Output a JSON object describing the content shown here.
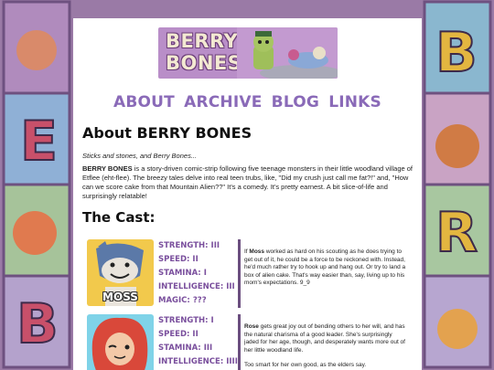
{
  "banner": {
    "title_line1": "BERRY",
    "title_line2": "BONES"
  },
  "nav": {
    "items": [
      "ABOUT",
      "ARCHIVE",
      "BLOG",
      "LINKS"
    ]
  },
  "about": {
    "title": "About BERRY BONES",
    "tagline": "Sticks and stones, and Berry Bones...",
    "intro_bold": "BERRY BONES",
    "intro_rest": " is a story-driven comic-strip following five teenage monsters in their little woodland village of Etflee (eht-flee). The breezy tales delve into real teen trubs, like, \"Did my crush just call me fat?!\" and, \"How can we score cake from that Mountain Alien??\" It's a comedy. It's pretty earnest. A bit slice-of-life and surprisingly relatable!"
  },
  "cast": {
    "title": "The Cast:",
    "characters": [
      {
        "name": "MOSS",
        "portrait_bg": "#f2c94c",
        "stats": [
          {
            "label": "STRENGTH:",
            "value": "III"
          },
          {
            "label": "SPEED:",
            "value": "II"
          },
          {
            "label": "STAMINA:",
            "value": "I"
          },
          {
            "label": "INTELLIGENCE:",
            "value": "III"
          },
          {
            "label": "MAGIC:",
            "value": "???"
          }
        ],
        "desc_lead": "If ",
        "desc_name": "Moss",
        "desc_rest": " worked as hard on his scouting as he does trying to get out of it, he could be a force to be reckoned with. Instead, he'd much rather try to hook up and hang out. Or try to land a box of alien cake. That's way easier than, say, living up to his mom's expectations. 9_9"
      },
      {
        "name": "ROSE",
        "portrait_bg": "#7fd3e8",
        "stats": [
          {
            "label": "STRENGTH:",
            "value": "I"
          },
          {
            "label": "SPEED:",
            "value": "II"
          },
          {
            "label": "STAMINA:",
            "value": "III"
          },
          {
            "label": "INTELLIGENCE:",
            "value": "IIII"
          }
        ],
        "desc_lead": "",
        "desc_name": "Rose",
        "desc_rest": " gets great joy out of bending others to her will, and has the natural charisma of a good leader. She's surprisingly jaded for her age, though, and desperately wants more out of her little woodland life.",
        "desc_extra": "Too smart for her own good, as the elders say."
      }
    ]
  }
}
